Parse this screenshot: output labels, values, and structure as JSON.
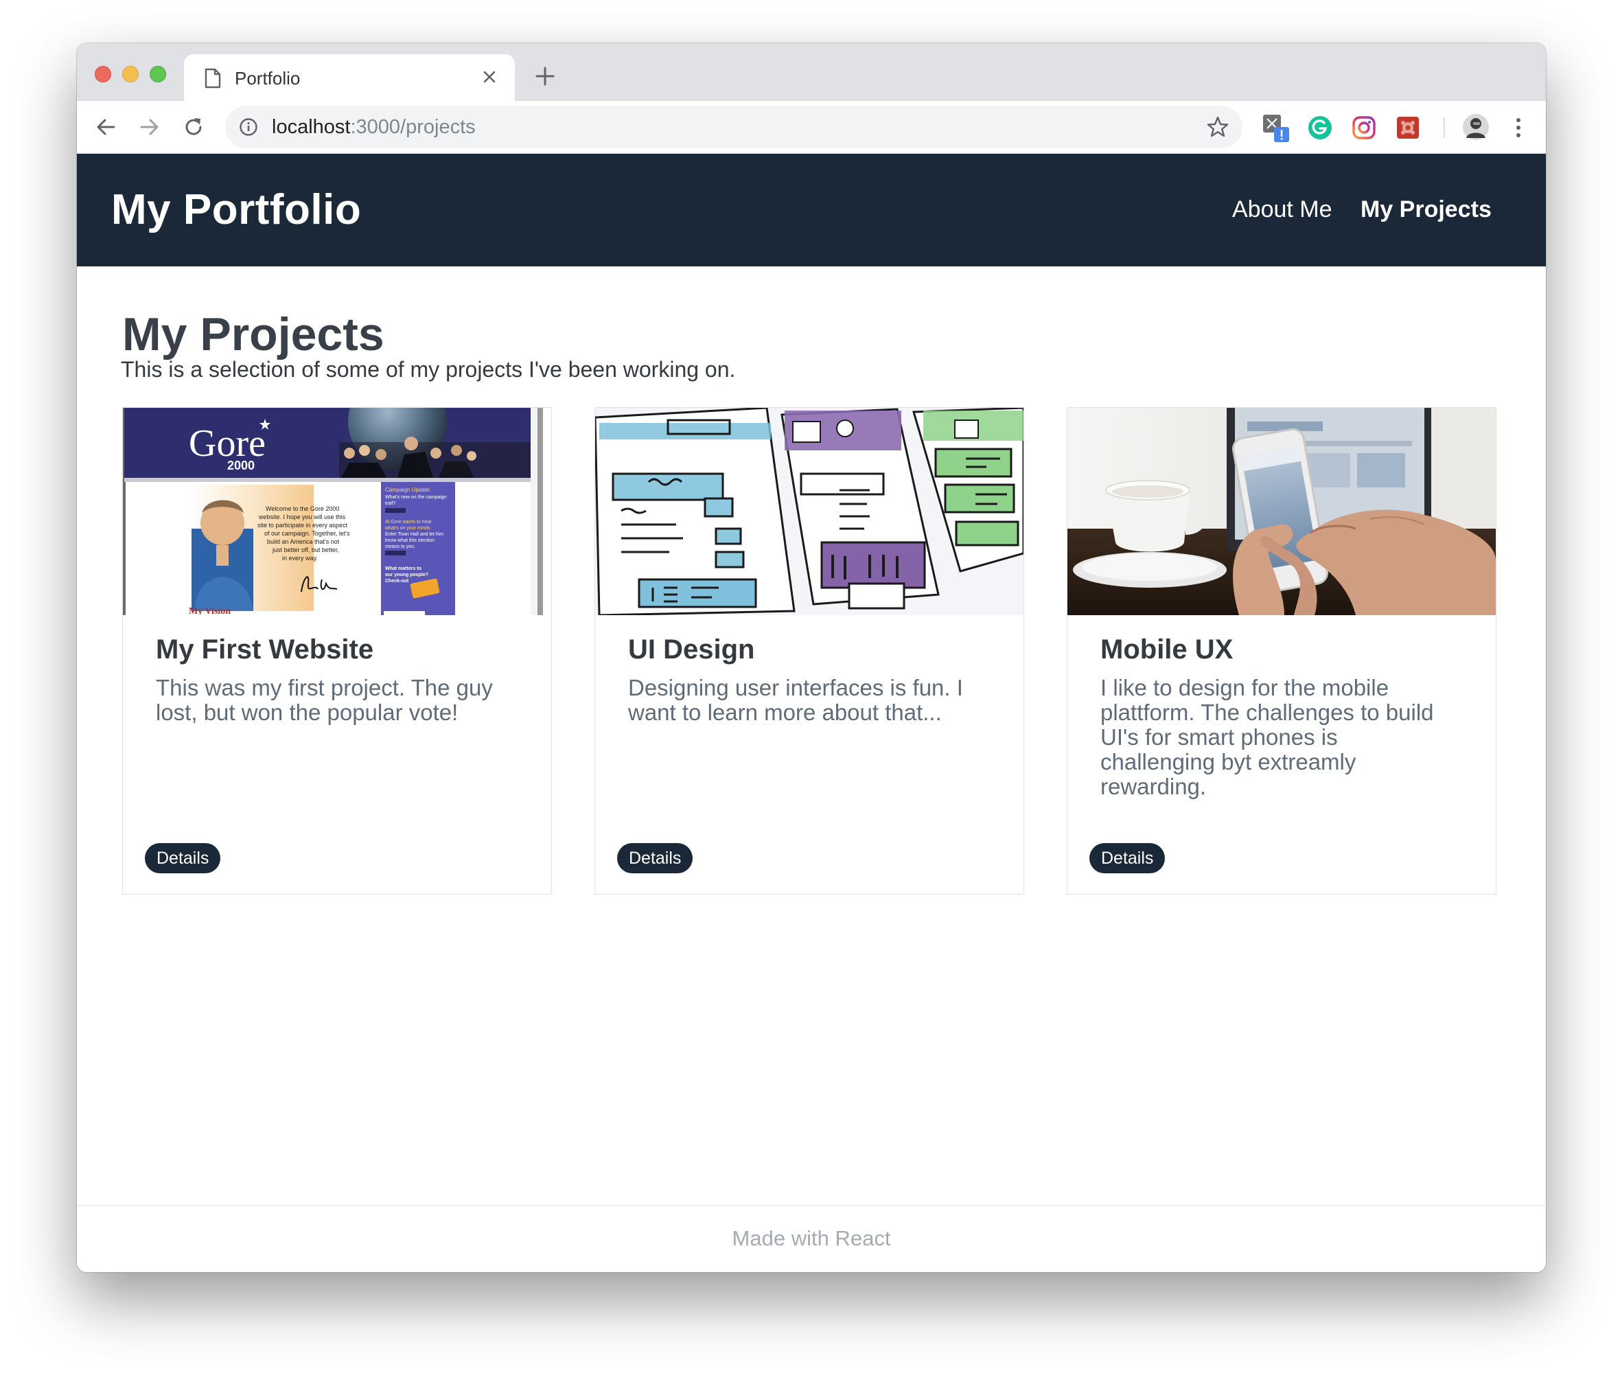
{
  "browser": {
    "tab_title": "Portfolio",
    "url_host": "localhost",
    "url_path": ":3000/projects",
    "icons": [
      "page-icon",
      "close-icon",
      "plus-icon",
      "back-arrow-icon",
      "forward-arrow-icon",
      "reload-icon",
      "info-icon",
      "star-icon",
      "extension-icon",
      "grammarly-icon",
      "instagram-icon",
      "devtools-icon",
      "profile-avatar",
      "more-menu-icon"
    ]
  },
  "site": {
    "brand": "My Portfolio",
    "nav": {
      "about": "About Me",
      "projects": "My Projects"
    },
    "header_color": "#1b2838"
  },
  "page": {
    "title": "My Projects",
    "subtitle": "This is a selection of some of my projects I've been working on."
  },
  "cards": [
    {
      "title": "My First Website",
      "text": "This was my first project. The guy lost, but won the popular vote!",
      "button": "Details",
      "image": {
        "banner_logo": "Gore",
        "banner_year": "2000",
        "welcome": "Welcome to the Gore 2000 website. I hope you will use this site to participate in every aspect of our campaign. Together, let's build an America that's not just better off, but better, in every way.",
        "sidebar_heading": "Campaign Update:",
        "sidebar_line": "What's new on the campaign trail?",
        "sidebar_more": "more",
        "sidebar_heading2": "Al Gore wants to hear what's on your minds",
        "sidebar_line2": "Enter Town Hall and let him know what this election means to you.",
        "sidebar_more2": "more",
        "sidebar_heading3": "What matters to our young people? Check-out",
        "signature": "Al Gore",
        "caption": "My Vision"
      }
    },
    {
      "title": "UI Design",
      "text": "Designing user interfaces is fun. I want to learn more about that...",
      "button": "Details"
    },
    {
      "title": "Mobile UX",
      "text": "I like to design for the mobile plattform. The challenges to build UI's for smart phones is challenging byt extreamly rewarding.",
      "button": "Details"
    }
  ],
  "footer": {
    "text": "Made with React"
  }
}
